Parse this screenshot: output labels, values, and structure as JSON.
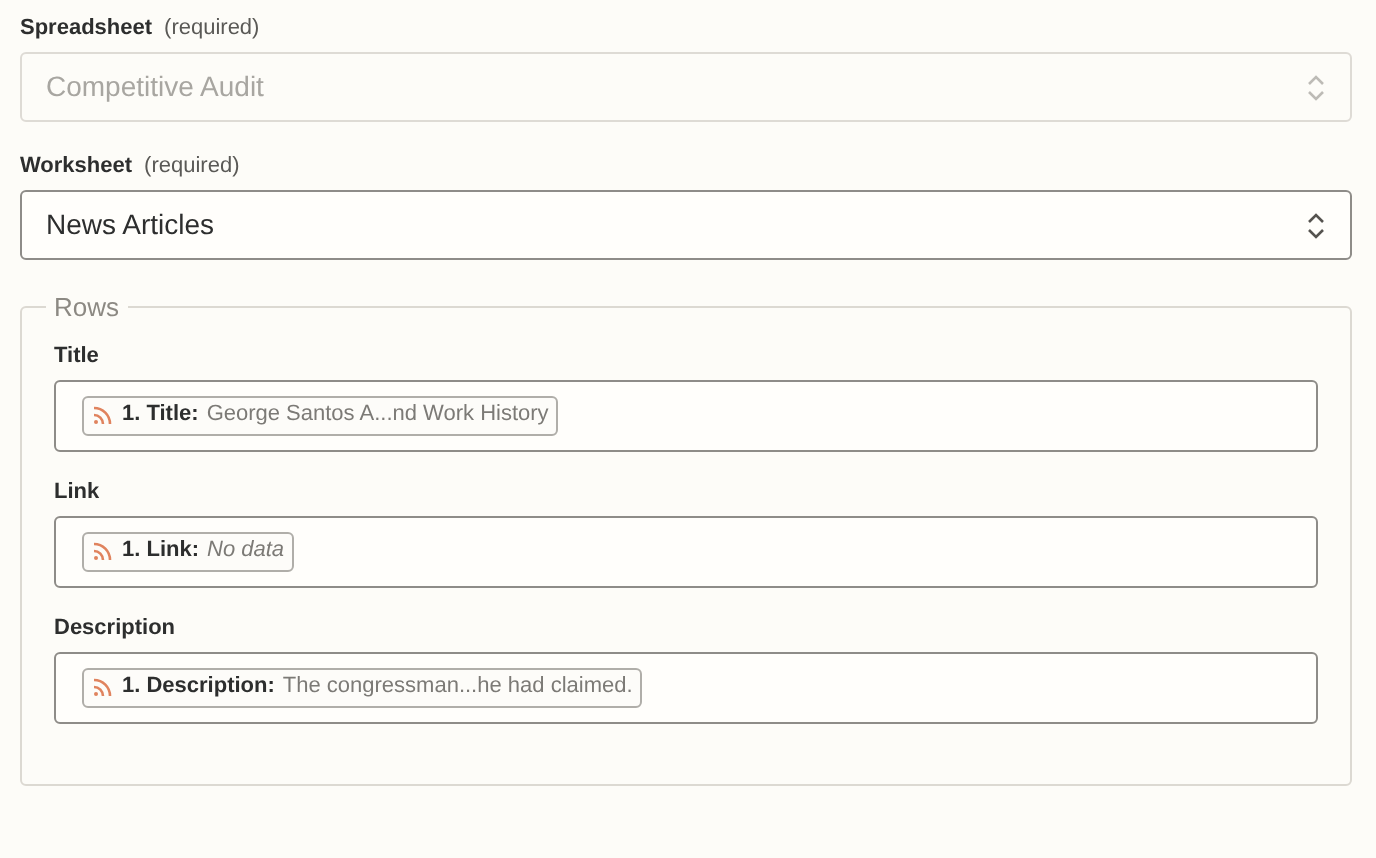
{
  "selects": [
    {
      "label": "Spreadsheet",
      "hint": "(required)",
      "value": "Competitive Audit",
      "disabled": true
    },
    {
      "label": "Worksheet",
      "hint": "(required)",
      "value": "News Articles",
      "disabled": false
    }
  ],
  "rows": {
    "legend": "Rows",
    "fields": [
      {
        "label": "Title",
        "pill": {
          "label": "1. Title:",
          "value": "George Santos A...nd Work History",
          "empty": false
        }
      },
      {
        "label": "Link",
        "pill": {
          "label": "1. Link:",
          "value": "No data",
          "empty": true
        }
      },
      {
        "label": "Description",
        "pill": {
          "label": "1. Description:",
          "value": "The congressman...he had claimed.",
          "empty": false
        }
      }
    ]
  }
}
